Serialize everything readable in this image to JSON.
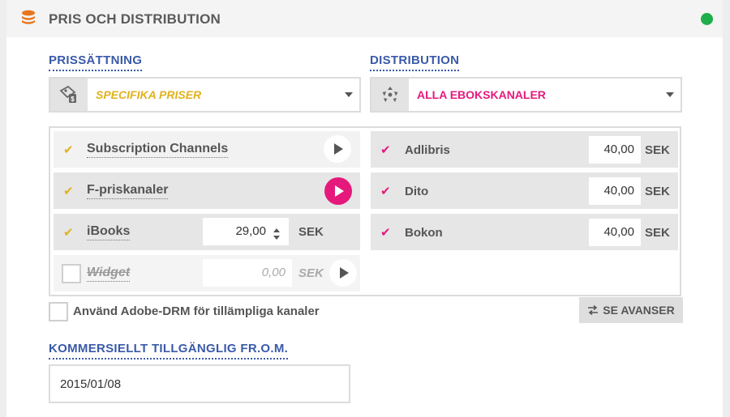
{
  "header": {
    "title": "PRIS OCH DISTRIBUTION"
  },
  "pricing": {
    "label": "PRISSÄTTNING",
    "selected": "SPECIFIKA PRISER",
    "color": "#e0b21d"
  },
  "distribution": {
    "label": "DISTRIBUTION",
    "selected": "ALLA EBOKSKANALER",
    "color": "#e5197c"
  },
  "price_channels": [
    {
      "name": "Subscription Channels",
      "checked": true
    },
    {
      "name": "F-priskanaler",
      "checked": true
    },
    {
      "name": "iBooks",
      "checked": true,
      "value": "29,00",
      "currency": "SEK"
    },
    {
      "name": "Widget",
      "checked": false,
      "value": "0,00",
      "currency": "SEK"
    }
  ],
  "distribution_channels": [
    {
      "name": "Adlibris",
      "value": "40,00",
      "currency": "SEK"
    },
    {
      "name": "Dito",
      "value": "40,00",
      "currency": "SEK"
    },
    {
      "name": "Bokon",
      "value": "40,00",
      "currency": "SEK"
    }
  ],
  "drm": {
    "label": "Använd Adobe-DRM för tillämpliga kanaler",
    "checked": false
  },
  "advanced_button": {
    "label": "SE AVANSER"
  },
  "availability": {
    "label": "KOMMERSIELLT TILLGÄNGLIG FR.O.M.",
    "date": "2015/01/08"
  },
  "status_color": "#1fae4b"
}
